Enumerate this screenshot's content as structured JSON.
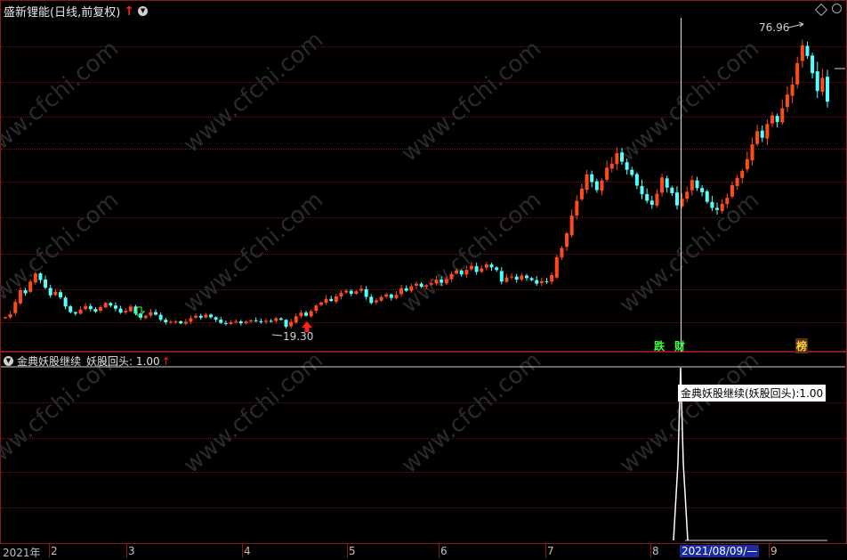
{
  "header": {
    "stock_title": "盛新锂能(日线,前复权)",
    "arrow_glyph": "↑"
  },
  "price_labels": {
    "high": "76.96",
    "low": "19.30"
  },
  "events": [
    {
      "text": "跌",
      "color": "#40ff40"
    },
    {
      "text": "财",
      "color": "#40ff40"
    },
    {
      "text": "榜",
      "color": "#ffd040"
    }
  ],
  "indicator": {
    "name": "金典妖股继续",
    "series_text": "妖股回头: 1.00",
    "arrow_glyph": "↑",
    "tooltip": "金典妖股继续(妖股回头):1.00"
  },
  "date_axis": {
    "labels": [
      "2021年",
      "2",
      "3",
      "4",
      "5",
      "6",
      "7",
      "8",
      "9"
    ],
    "cursor_date": "2021/08/09/—"
  },
  "watermark": "www.cfchi.com",
  "colors": {
    "up": "#ff4a1a",
    "down": "#54ffff",
    "grid": "#7a1515",
    "background": "#000000"
  },
  "chart_data": {
    "type": "candlestick",
    "price_range": [
      18,
      80
    ],
    "closes": [
      21.8,
      22.4,
      24.8,
      27.1,
      26.5,
      28.8,
      30.4,
      29.1,
      27.6,
      26.1,
      26.8,
      25.7,
      23.9,
      22.8,
      22.5,
      23.3,
      24.0,
      23.4,
      22.9,
      23.8,
      24.6,
      24.1,
      23.5,
      22.7,
      23.1,
      23.9,
      22.5,
      21.7,
      22.1,
      22.8,
      22.3,
      21.3,
      20.8,
      20.9,
      21.0,
      20.6,
      20.9,
      21.6,
      22.1,
      21.7,
      22.3,
      21.8,
      21.3,
      20.7,
      20.5,
      20.8,
      21.0,
      20.6,
      20.9,
      21.2,
      21.0,
      20.8,
      21.1,
      21.0,
      21.6,
      21.3,
      19.9,
      20.9,
      22.0,
      22.7,
      22.1,
      23.0,
      24.1,
      24.7,
      25.4,
      25.0,
      25.9,
      26.6,
      27.0,
      26.4,
      26.9,
      27.4,
      25.8,
      24.6,
      25.1,
      25.8,
      26.3,
      25.6,
      26.2,
      27.5,
      27.0,
      27.9,
      28.4,
      27.8,
      28.1,
      28.5,
      29.2,
      28.6,
      29.3,
      30.3,
      31.0,
      30.2,
      31.1,
      31.9,
      30.7,
      31.4,
      32.2,
      31.6,
      31.1,
      28.8,
      29.6,
      29.8,
      29.2,
      30.0,
      29.5,
      29.1,
      28.4,
      28.9,
      28.7,
      30.1,
      33.6,
      35.4,
      38.3,
      41.8,
      44.7,
      47.1,
      49.9,
      48.4,
      46.8,
      48.7,
      51.2,
      52.0,
      54.1,
      52.4,
      50.8,
      49.8,
      47.7,
      46.0,
      44.7,
      43.9,
      46.1,
      49.3,
      47.3,
      46.2,
      43.8,
      45.1,
      46.5,
      48.8,
      47.2,
      46.4,
      44.5,
      43.3,
      42.9,
      44.1,
      45.3,
      47.8,
      49.2,
      50.6,
      52.9,
      55.8,
      58.4,
      57.1,
      59.8,
      61.5,
      60.2,
      62.9,
      65.6,
      67.6,
      71.8,
      75.3,
      73.2,
      69.8,
      66.3,
      68.9,
      64.2
    ]
  }
}
